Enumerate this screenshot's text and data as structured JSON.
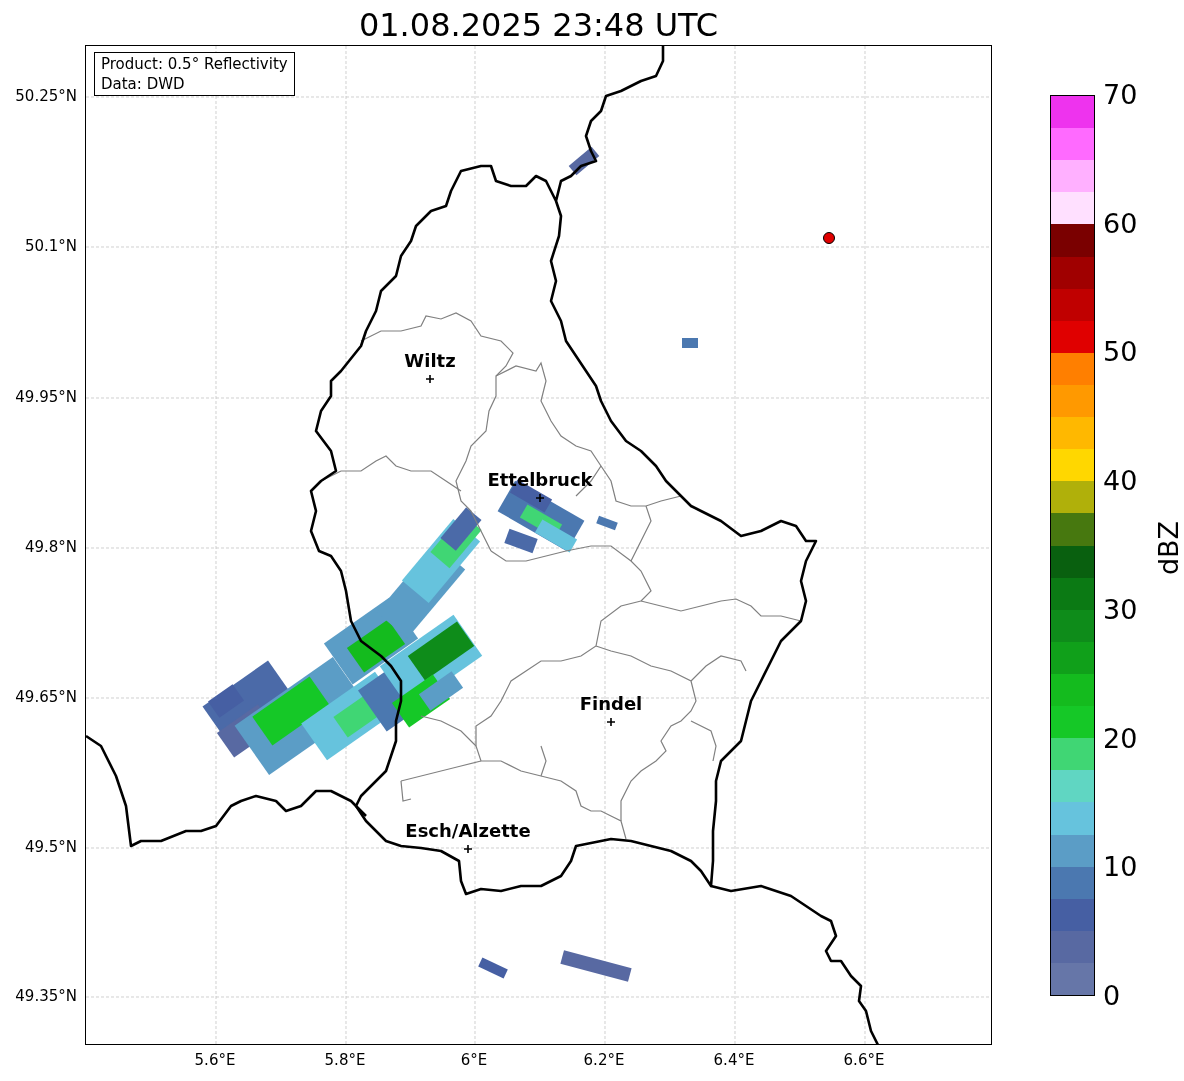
{
  "title": "01.08.2025 23:48 UTC",
  "info_box": {
    "lines": [
      "Product: 0.5° Reflectivity",
      "Data: DWD"
    ]
  },
  "lat_ticks": [
    "50.25°N",
    "50.1°N",
    "49.95°N",
    "49.8°N",
    "49.65°N",
    "49.5°N",
    "49.35°N"
  ],
  "lon_ticks": [
    "5.6°E",
    "5.8°E",
    "6°E",
    "6.2°E",
    "6.4°E",
    "6.6°E"
  ],
  "cities": [
    {
      "name": "Wiltz"
    },
    {
      "name": "Ettelbruck"
    },
    {
      "name": "Findel"
    },
    {
      "name": "Esch/Alzette"
    }
  ],
  "colorbar": {
    "label": "dBZ",
    "ticks": [
      "70",
      "60",
      "50",
      "40",
      "30",
      "20",
      "10",
      "0"
    ],
    "levels": [
      {
        "color": "#ee33ee"
      },
      {
        "color": "#ff6aff"
      },
      {
        "color": "#ffb0ff"
      },
      {
        "color": "#ffe0ff"
      },
      {
        "color": "#7a0000"
      },
      {
        "color": "#a00000"
      },
      {
        "color": "#c00000"
      },
      {
        "color": "#e00000"
      },
      {
        "color": "#ff7f00"
      },
      {
        "color": "#ff9900"
      },
      {
        "color": "#ffb800"
      },
      {
        "color": "#ffd700"
      },
      {
        "color": "#b0b00a"
      },
      {
        "color": "#47780f"
      },
      {
        "color": "#09600f"
      },
      {
        "color": "#0b7a14"
      },
      {
        "color": "#0e8c1a"
      },
      {
        "color": "#10a01a"
      },
      {
        "color": "#14bb1e"
      },
      {
        "color": "#15c827"
      },
      {
        "color": "#40d674"
      },
      {
        "color": "#60d6c2"
      },
      {
        "color": "#66c3dd"
      },
      {
        "color": "#5b9dc6"
      },
      {
        "color": "#4b78b0"
      },
      {
        "color": "#465fa3"
      },
      {
        "color": "#5869a2"
      },
      {
        "color": "#6676a8"
      }
    ]
  }
}
